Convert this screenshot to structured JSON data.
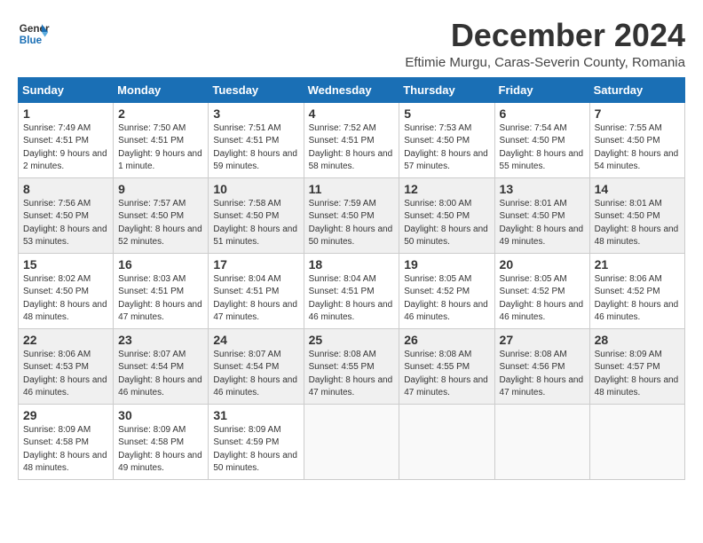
{
  "logo": {
    "line1": "General",
    "line2": "Blue"
  },
  "title": "December 2024",
  "subtitle": "Eftimie Murgu, Caras-Severin County, Romania",
  "headers": [
    "Sunday",
    "Monday",
    "Tuesday",
    "Wednesday",
    "Thursday",
    "Friday",
    "Saturday"
  ],
  "weeks": [
    [
      {
        "day": "1",
        "sunrise": "7:49 AM",
        "sunset": "4:51 PM",
        "daylight": "9 hours and 2 minutes."
      },
      {
        "day": "2",
        "sunrise": "7:50 AM",
        "sunset": "4:51 PM",
        "daylight": "9 hours and 1 minute."
      },
      {
        "day": "3",
        "sunrise": "7:51 AM",
        "sunset": "4:51 PM",
        "daylight": "8 hours and 59 minutes."
      },
      {
        "day": "4",
        "sunrise": "7:52 AM",
        "sunset": "4:51 PM",
        "daylight": "8 hours and 58 minutes."
      },
      {
        "day": "5",
        "sunrise": "7:53 AM",
        "sunset": "4:50 PM",
        "daylight": "8 hours and 57 minutes."
      },
      {
        "day": "6",
        "sunrise": "7:54 AM",
        "sunset": "4:50 PM",
        "daylight": "8 hours and 55 minutes."
      },
      {
        "day": "7",
        "sunrise": "7:55 AM",
        "sunset": "4:50 PM",
        "daylight": "8 hours and 54 minutes."
      }
    ],
    [
      {
        "day": "8",
        "sunrise": "7:56 AM",
        "sunset": "4:50 PM",
        "daylight": "8 hours and 53 minutes."
      },
      {
        "day": "9",
        "sunrise": "7:57 AM",
        "sunset": "4:50 PM",
        "daylight": "8 hours and 52 minutes."
      },
      {
        "day": "10",
        "sunrise": "7:58 AM",
        "sunset": "4:50 PM",
        "daylight": "8 hours and 51 minutes."
      },
      {
        "day": "11",
        "sunrise": "7:59 AM",
        "sunset": "4:50 PM",
        "daylight": "8 hours and 50 minutes."
      },
      {
        "day": "12",
        "sunrise": "8:00 AM",
        "sunset": "4:50 PM",
        "daylight": "8 hours and 50 minutes."
      },
      {
        "day": "13",
        "sunrise": "8:01 AM",
        "sunset": "4:50 PM",
        "daylight": "8 hours and 49 minutes."
      },
      {
        "day": "14",
        "sunrise": "8:01 AM",
        "sunset": "4:50 PM",
        "daylight": "8 hours and 48 minutes."
      }
    ],
    [
      {
        "day": "15",
        "sunrise": "8:02 AM",
        "sunset": "4:50 PM",
        "daylight": "8 hours and 48 minutes."
      },
      {
        "day": "16",
        "sunrise": "8:03 AM",
        "sunset": "4:51 PM",
        "daylight": "8 hours and 47 minutes."
      },
      {
        "day": "17",
        "sunrise": "8:04 AM",
        "sunset": "4:51 PM",
        "daylight": "8 hours and 47 minutes."
      },
      {
        "day": "18",
        "sunrise": "8:04 AM",
        "sunset": "4:51 PM",
        "daylight": "8 hours and 46 minutes."
      },
      {
        "day": "19",
        "sunrise": "8:05 AM",
        "sunset": "4:52 PM",
        "daylight": "8 hours and 46 minutes."
      },
      {
        "day": "20",
        "sunrise": "8:05 AM",
        "sunset": "4:52 PM",
        "daylight": "8 hours and 46 minutes."
      },
      {
        "day": "21",
        "sunrise": "8:06 AM",
        "sunset": "4:52 PM",
        "daylight": "8 hours and 46 minutes."
      }
    ],
    [
      {
        "day": "22",
        "sunrise": "8:06 AM",
        "sunset": "4:53 PM",
        "daylight": "8 hours and 46 minutes."
      },
      {
        "day": "23",
        "sunrise": "8:07 AM",
        "sunset": "4:54 PM",
        "daylight": "8 hours and 46 minutes."
      },
      {
        "day": "24",
        "sunrise": "8:07 AM",
        "sunset": "4:54 PM",
        "daylight": "8 hours and 46 minutes."
      },
      {
        "day": "25",
        "sunrise": "8:08 AM",
        "sunset": "4:55 PM",
        "daylight": "8 hours and 47 minutes."
      },
      {
        "day": "26",
        "sunrise": "8:08 AM",
        "sunset": "4:55 PM",
        "daylight": "8 hours and 47 minutes."
      },
      {
        "day": "27",
        "sunrise": "8:08 AM",
        "sunset": "4:56 PM",
        "daylight": "8 hours and 47 minutes."
      },
      {
        "day": "28",
        "sunrise": "8:09 AM",
        "sunset": "4:57 PM",
        "daylight": "8 hours and 48 minutes."
      }
    ],
    [
      {
        "day": "29",
        "sunrise": "8:09 AM",
        "sunset": "4:58 PM",
        "daylight": "8 hours and 48 minutes."
      },
      {
        "day": "30",
        "sunrise": "8:09 AM",
        "sunset": "4:58 PM",
        "daylight": "8 hours and 49 minutes."
      },
      {
        "day": "31",
        "sunrise": "8:09 AM",
        "sunset": "4:59 PM",
        "daylight": "8 hours and 50 minutes."
      },
      null,
      null,
      null,
      null
    ]
  ],
  "daylight_label": "Daylight:",
  "sunrise_prefix": "Sunrise:",
  "sunset_prefix": "Sunset:"
}
